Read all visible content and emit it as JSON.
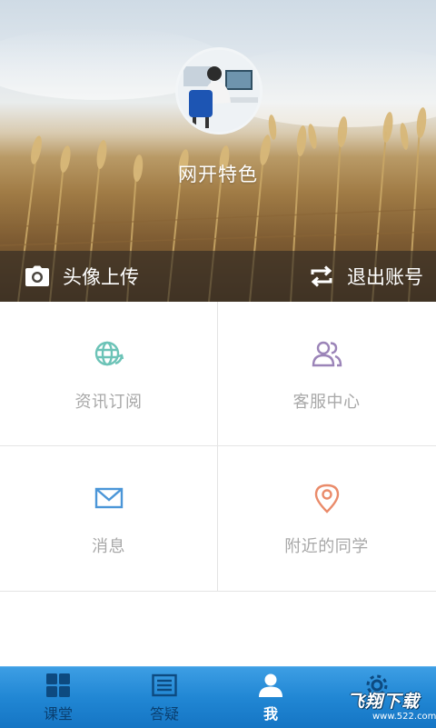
{
  "profile": {
    "username": "网开特色",
    "avatar_icon": "user-avatar-photo"
  },
  "actions": {
    "upload_avatar": {
      "label": "头像上传",
      "icon": "camera-icon"
    },
    "logout": {
      "label": "退出账号",
      "icon": "swap-arrows-icon"
    }
  },
  "menu": {
    "items": [
      {
        "label": "资讯订阅",
        "icon": "globe-refresh-icon",
        "color": "#6cc3b7"
      },
      {
        "label": "客服中心",
        "icon": "users-icon",
        "color": "#9b84b8"
      },
      {
        "label": "消息",
        "icon": "envelope-icon",
        "color": "#4b96d8"
      },
      {
        "label": "附近的同学",
        "icon": "location-pin-icon",
        "color": "#ea8b6a"
      }
    ]
  },
  "tabbar": {
    "tabs": [
      {
        "label": "课堂",
        "icon": "grid-icon",
        "active": false
      },
      {
        "label": "答疑",
        "icon": "list-icon",
        "active": false
      },
      {
        "label": "我",
        "icon": "person-icon",
        "active": true
      },
      {
        "label": "",
        "icon": "gear-icon",
        "active": false
      }
    ]
  },
  "watermark": {
    "title": "飞翔下载",
    "url": "www.522.com"
  },
  "colors": {
    "tabbar": "#2187d4",
    "active_tab_text": "#ffffff",
    "inactive_tab_text": "#0a3f70",
    "menu_label": "#a8a8a8"
  }
}
